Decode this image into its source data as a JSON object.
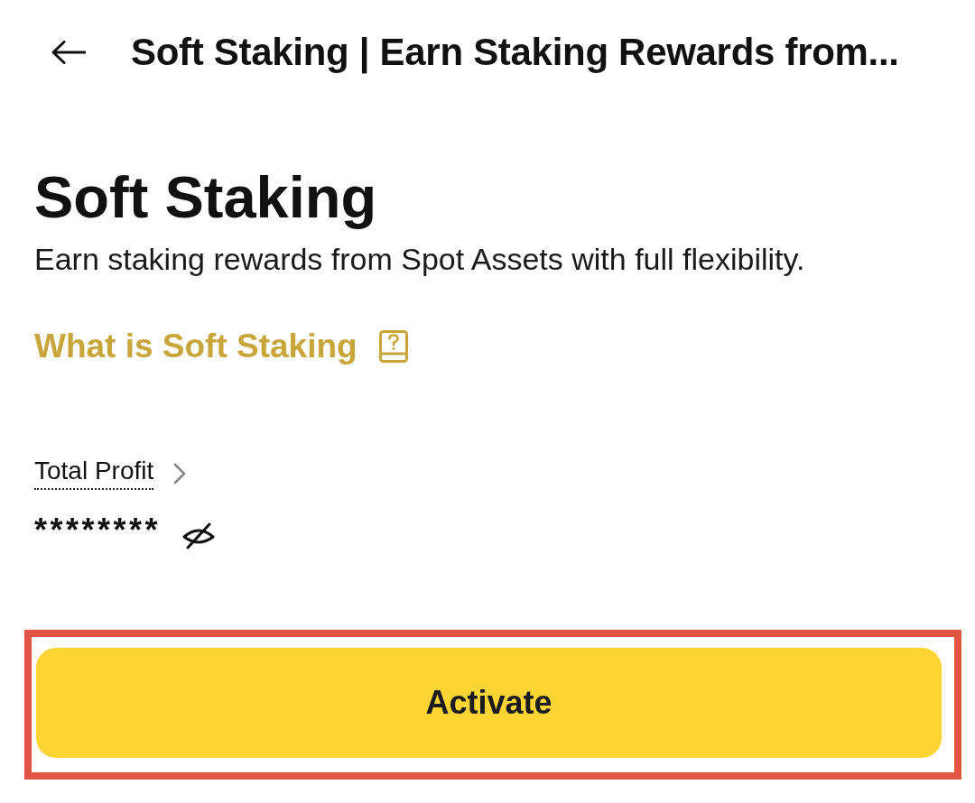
{
  "header": {
    "title": "Soft Staking | Earn Staking Rewards from..."
  },
  "hero": {
    "title": "Soft Staking",
    "subtitle": "Earn staking rewards from Spot Assets with full flexibility."
  },
  "info_link": {
    "label": "What is Soft Staking"
  },
  "profit": {
    "label": "Total Profit",
    "value": "********",
    "hidden": true
  },
  "primary_button": {
    "label": "Activate",
    "highlighted": true
  }
}
